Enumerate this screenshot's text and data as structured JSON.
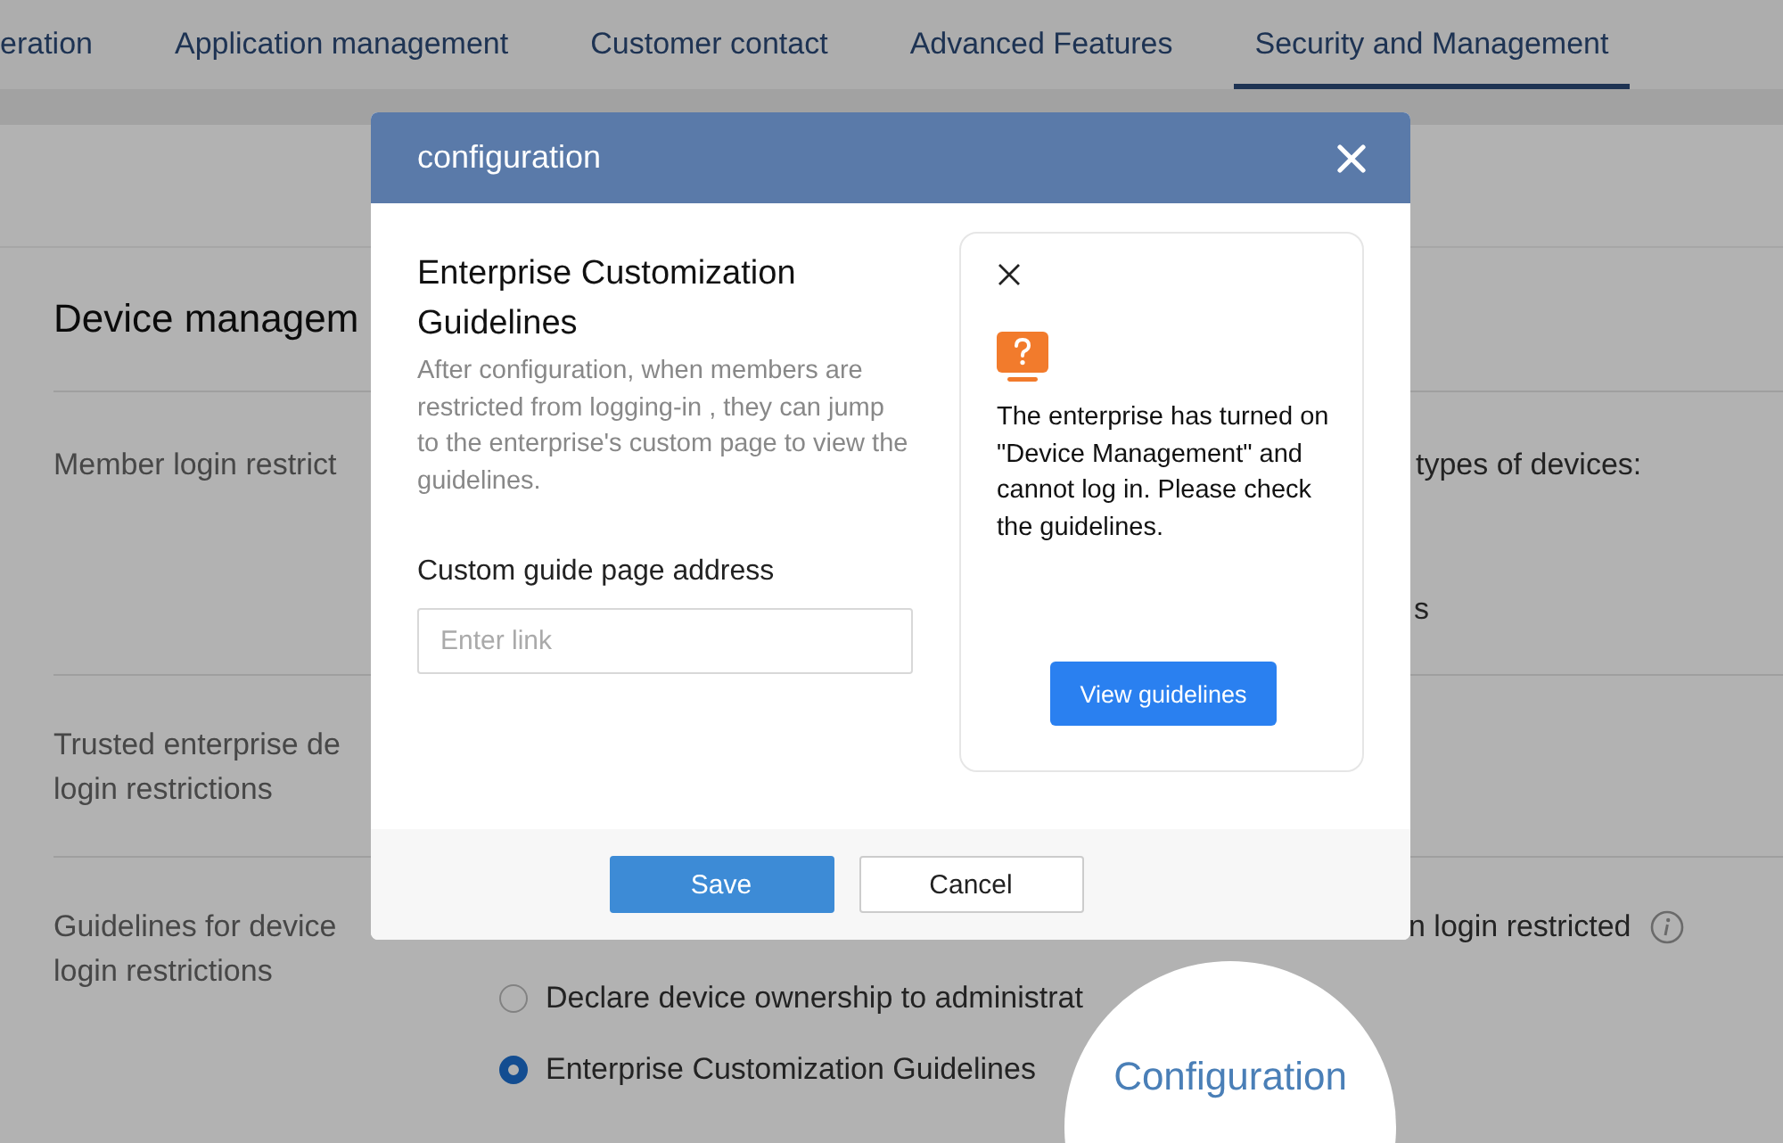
{
  "tabs": [
    {
      "label": "eration",
      "selected": false
    },
    {
      "label": "Application management",
      "selected": false
    },
    {
      "label": "Customer contact",
      "selected": false
    },
    {
      "label": "Advanced Features",
      "selected": false
    },
    {
      "label": "Security and Management",
      "selected": true
    }
  ],
  "section": {
    "title": "Device managem",
    "rows": [
      {
        "label": [
          "Member login restrict"
        ],
        "fragments": [
          "types of devices:",
          "s"
        ]
      },
      {
        "label": [
          "Trusted enterprise de",
          "login restrictions"
        ],
        "fragments": []
      },
      {
        "label": [
          "Guidelines for device",
          "login restrictions"
        ],
        "fragments": [
          "n login restricted"
        ],
        "options": [
          {
            "label": "Declare device ownership to administrat",
            "selected": false
          },
          {
            "label": "Enterprise Customization Guidelines",
            "selected": true
          }
        ]
      }
    ]
  },
  "modal": {
    "title": "configuration",
    "heading": "Enterprise Customization Guidelines",
    "description": "After configuration, when members are restricted from logging-in , they can jump to the enterprise's custom page to view the guidelines.",
    "field_label": "Custom guide page address",
    "field": {
      "placeholder": "Enter link"
    },
    "preview": {
      "message": "The enterprise has turned on \"Device Management\" and cannot log in. Please check the guidelines.",
      "button": "View guidelines"
    },
    "buttons": [
      "Save",
      "Cancel"
    ]
  },
  "magnifier": {
    "label": "Configuration"
  }
}
